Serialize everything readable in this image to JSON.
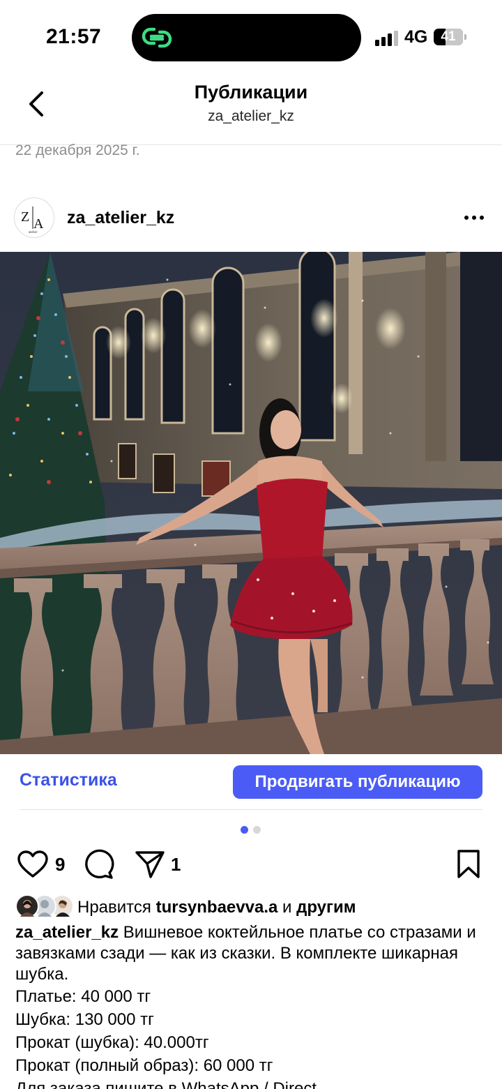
{
  "status_bar": {
    "time": "21:57",
    "network": "4G",
    "battery": "41",
    "battery_level": 0.41,
    "island_icon": "link-icon"
  },
  "header": {
    "back_icon": "chevron-left-icon",
    "title": "Публикации",
    "subtitle": "za_atelier_kz"
  },
  "date_label": "22 декабря 2025 г.",
  "post": {
    "username": "za_atelier_kz",
    "avatar_logo": "ZA atelier",
    "more_icon": "more-horizontal-icon",
    "photo_description_icon": "photo",
    "stats_label": "Статистика",
    "promote_label": "Продвигать публикацию",
    "carousel": {
      "count": 2,
      "active": 1
    },
    "like_count": "9",
    "share_count": "1",
    "liked_by_prefix": "Нравится",
    "liked_by_user": "tursynbaevva.a",
    "liked_by_and": "и",
    "liked_by_others": "другим",
    "caption_user": "za_atelier_kz",
    "caption_text": "Вишневое коктейльное платье со стразами и завязками сзади — как из сказки. В комплекте шикарная шубка.",
    "lines": [
      "Платье: 40 000 тг",
      "Шубка: 130 000 тг",
      "Прокат (шубка): 40.000тг",
      "Прокат (полный образ): 60 000 тг",
      "Для заказа пишите в WhatsApp / Direct"
    ]
  },
  "colors": {
    "accent": "#3a52e8",
    "button": "#4a5cf5",
    "dress": "#b0162a",
    "island_icon": "#3ddc84"
  }
}
